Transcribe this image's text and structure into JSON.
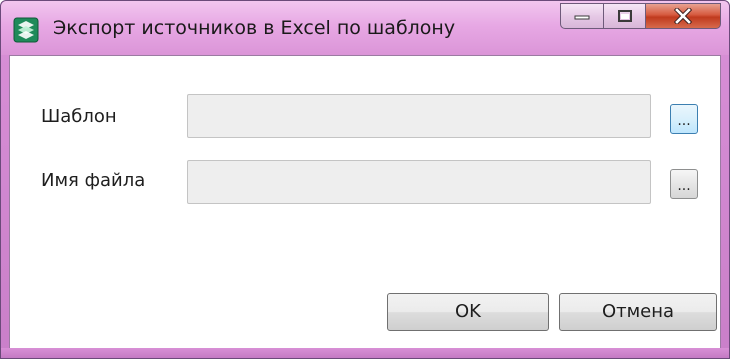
{
  "window": {
    "title": "Экспорт источников в Excel по шаблону",
    "icon": "excel-export-icon"
  },
  "caption_buttons": {
    "minimize_icon": "minimize-icon",
    "maximize_icon": "maximize-icon",
    "close_icon": "close-icon"
  },
  "form": {
    "template_label": "Шаблон",
    "template_value": "",
    "template_browse": "...",
    "filename_label": "Имя файла",
    "filename_value": "",
    "filename_browse": "..."
  },
  "buttons": {
    "ok": "OK",
    "cancel": "Отмена"
  },
  "colors": {
    "titlebar": "#e7a8e4",
    "close_button": "#d65a3f",
    "focused_button_border": "#3c7fb1"
  }
}
